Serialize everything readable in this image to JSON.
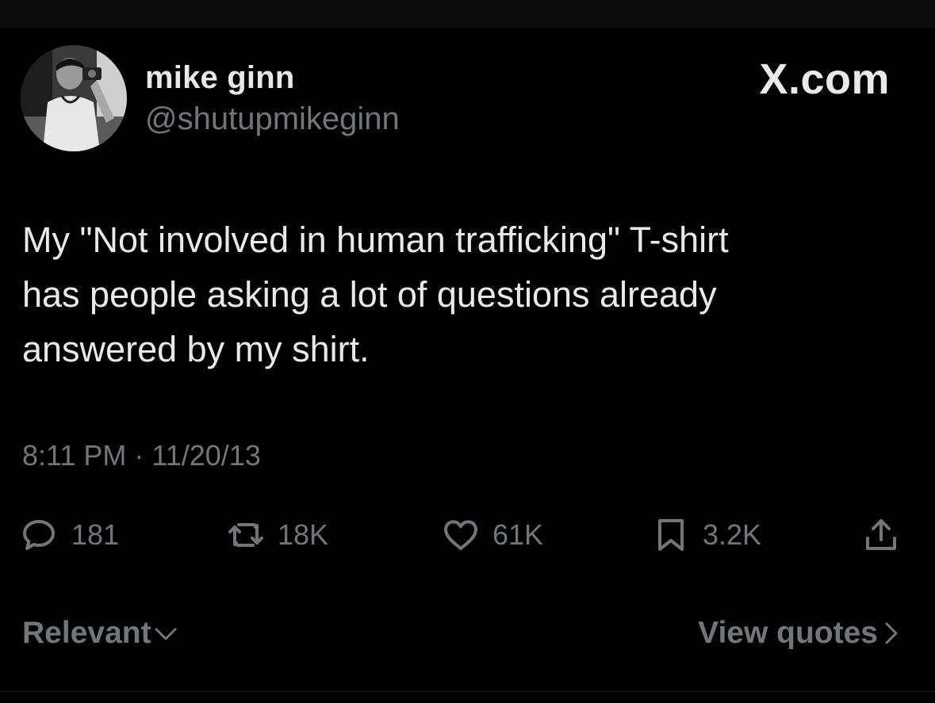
{
  "author": {
    "display_name": "mike ginn",
    "handle": "@shutupmikeginn"
  },
  "brand": "X.com",
  "tweet": {
    "text": "My \"Not involved in human trafficking\" T-shirt\nhas people asking a lot of questions already\nanswered by my shirt.",
    "timestamp": "8:11 PM · 11/20/13"
  },
  "stats": {
    "replies": "181",
    "reposts": "18K",
    "likes": "61K",
    "bookmarks": "3.2K"
  },
  "icons": {
    "reply": "reply-icon",
    "repost": "repost-icon",
    "like": "heart-icon",
    "bookmark": "bookmark-icon",
    "share": "share-icon"
  },
  "footer": {
    "sort_label": "Relevant",
    "quotes_label": "View quotes"
  },
  "colors": {
    "background": "#000000",
    "primary_text": "#e7e9ea",
    "secondary_text": "#71767b"
  }
}
